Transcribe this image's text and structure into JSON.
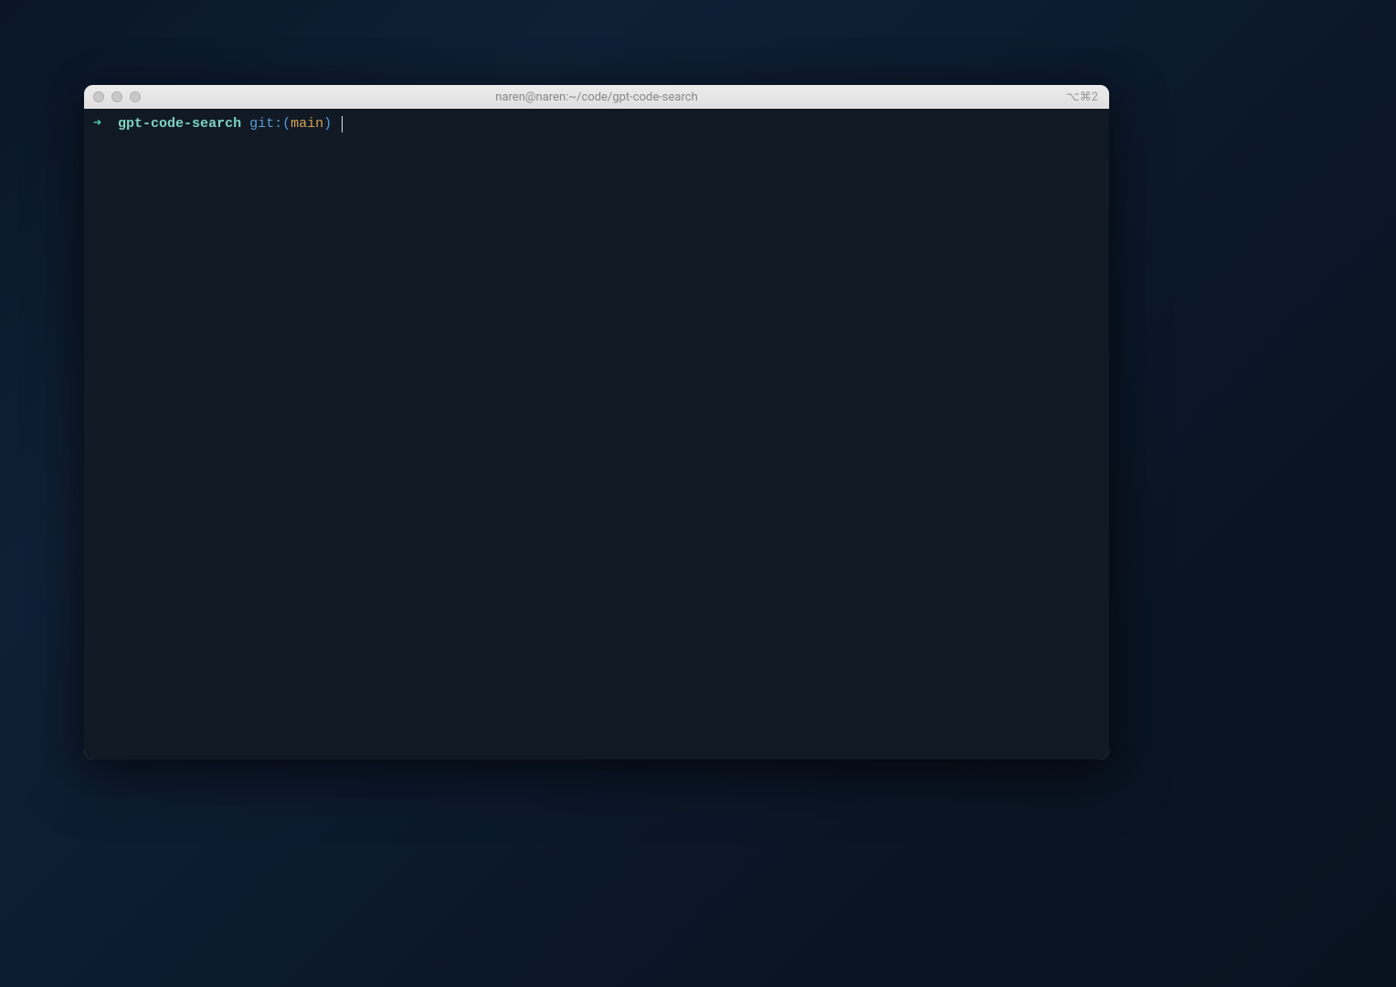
{
  "window": {
    "title": "naren@naren:~/code/gpt-code-search",
    "shortcut": "⌥⌘2"
  },
  "prompt": {
    "arrow": "➜  ",
    "directory": "gpt-code-search",
    "git_prefix": " git:",
    "git_paren_open": "(",
    "git_branch": "main",
    "git_paren_close": ")",
    "input": " "
  }
}
